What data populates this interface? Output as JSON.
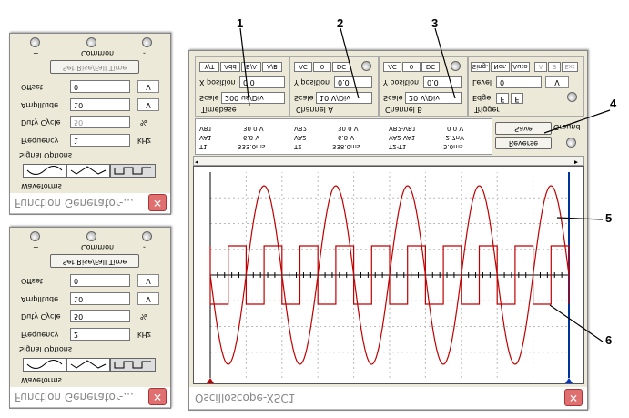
{
  "fg_top": {
    "title": "Function Generator-...",
    "waveforms_label": "Waveforms",
    "signal_options_label": "Signal Options",
    "frequency_label": "Frequency",
    "frequency_value": "2",
    "frequency_unit": "kHz",
    "duty_label": "Duty Cycle",
    "duty_value": "50",
    "duty_unit": "%",
    "amplitude_label": "Amplitude",
    "amplitude_value": "10",
    "amplitude_unit": "V",
    "offset_label": "Offset",
    "offset_value": "0",
    "offset_unit": "V",
    "rise_fall_button": "Set Rise/Fall Time",
    "plus_label": "+",
    "common_label": "Common",
    "minus_label": "-"
  },
  "fg_bottom": {
    "title": "Function Generator-...",
    "waveforms_label": "Waveforms",
    "signal_options_label": "Signal Options",
    "frequency_label": "Frequency",
    "frequency_value": "1",
    "frequency_unit": "kHz",
    "duty_label": "Duty Cycle",
    "duty_value": "50",
    "duty_unit": "%",
    "amplitude_label": "Amplitude",
    "amplitude_value": "10",
    "amplitude_unit": "V",
    "offset_label": "Offset",
    "offset_value": "0",
    "offset_unit": "V",
    "rise_fall_button": "Set Rise/Fall Time",
    "plus_label": "+",
    "common_label": "Common",
    "minus_label": "-"
  },
  "scope": {
    "title": "Oscilloscope-XSC1",
    "timebase": {
      "group_label": "Timebase",
      "scale_label": "Scale",
      "scale_value": "200 us/Div",
      "xpos_label": "X position",
      "xpos_value": "0.0",
      "tabs": [
        "Y/T",
        "Add",
        "B/A",
        "A/B"
      ]
    },
    "channel_a": {
      "group_label": "Channel A",
      "scale_label": "Scale",
      "scale_value": "10 V/Div",
      "ypos_label": "Y position",
      "ypos_value": "0.0",
      "tabs": [
        "AC",
        "0",
        "DC"
      ]
    },
    "channel_b": {
      "group_label": "Channel B",
      "scale_label": "Scale",
      "scale_value": "20 V/Div",
      "ypos_label": "Y position",
      "ypos_value": "0.0",
      "tabs": [
        "AC",
        "0",
        "DC"
      ]
    },
    "trigger": {
      "group_label": "Trigger",
      "edge_label": "Edge",
      "level_label": "Level",
      "level_value": "0",
      "level_unit": "V",
      "tabs": [
        "Sing.",
        "Nor.",
        "Auto"
      ],
      "src_tabs": [
        "A",
        "B",
        "Ext"
      ]
    },
    "measurements": {
      "t1_label": "T1",
      "t1_time": "333.0ms",
      "t1_va": "6.8 V",
      "t1_vb": "30.0 V",
      "t1_a_label": "VA1",
      "t1_b_label": "VB1",
      "t2_label": "T2",
      "t2_time": "338.0ms",
      "t2_va": "6.8 V",
      "t2_vb": "30.0 V",
      "t2_a_label": "VA2",
      "t2_b_label": "VB2",
      "d_label": "T2-T1",
      "d_time": "5.0ms",
      "d_va": "-2.7nV",
      "d_vb": "0.0 V",
      "d_a_label": "VA2-VA1",
      "d_b_label": "VB2-VB1"
    },
    "reverse_button": "Reverse",
    "save_button": "Save",
    "ground_label": "Ground"
  },
  "callouts": [
    "1",
    "2",
    "3",
    "4",
    "5",
    "6"
  ],
  "colors": {
    "sine_trace": "#c00000",
    "square_trace": "#c00000",
    "window_bg": "#ece9d8",
    "close_button": "#e07070"
  }
}
